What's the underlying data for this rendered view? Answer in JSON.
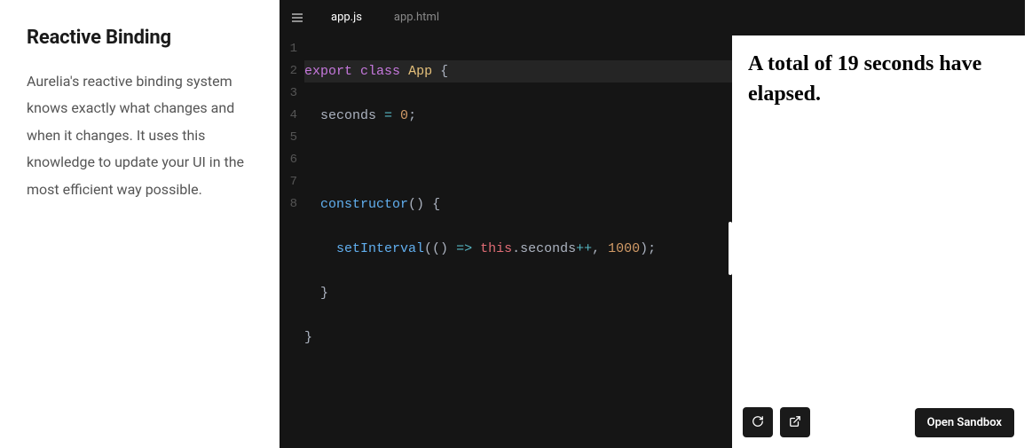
{
  "left": {
    "heading": "Reactive Binding",
    "paragraph": "Aurelia's reactive binding system knows exactly what changes and when it changes. It uses this knowledge to update your UI in the most efficient way possible."
  },
  "tabs": {
    "items": [
      {
        "label": "app.js",
        "active": true
      },
      {
        "label": "app.html",
        "active": false
      }
    ]
  },
  "code": {
    "line_count": 8,
    "lines": {
      "l1": {
        "kw1": "export",
        "kw2": "class",
        "cls": "App",
        "brace": " {"
      },
      "l2": {
        "indent": "  ",
        "prop": "seconds",
        "eq": " = ",
        "num": "0",
        "semi": ";"
      },
      "l3": {
        "blank": ""
      },
      "l4": {
        "indent": "  ",
        "fn": "constructor",
        "paren": "()",
        "brace": " {"
      },
      "l5": {
        "indent": "    ",
        "fn": "setInterval",
        "open": "(()",
        "arrow": " => ",
        "this": "this",
        "dot": ".",
        "prop": "seconds",
        "inc": "++",
        "sep": ", ",
        "num": "1000",
        "close": ");"
      },
      "l6": {
        "indent": "  ",
        "brace": "}"
      },
      "l7": {
        "brace": "}"
      },
      "l8": {
        "blank": ""
      }
    }
  },
  "preview": {
    "text_prefix": "A total of ",
    "seconds": "19",
    "text_suffix": " seconds have elapsed."
  },
  "footer": {
    "open_sandbox": "Open Sandbox"
  }
}
